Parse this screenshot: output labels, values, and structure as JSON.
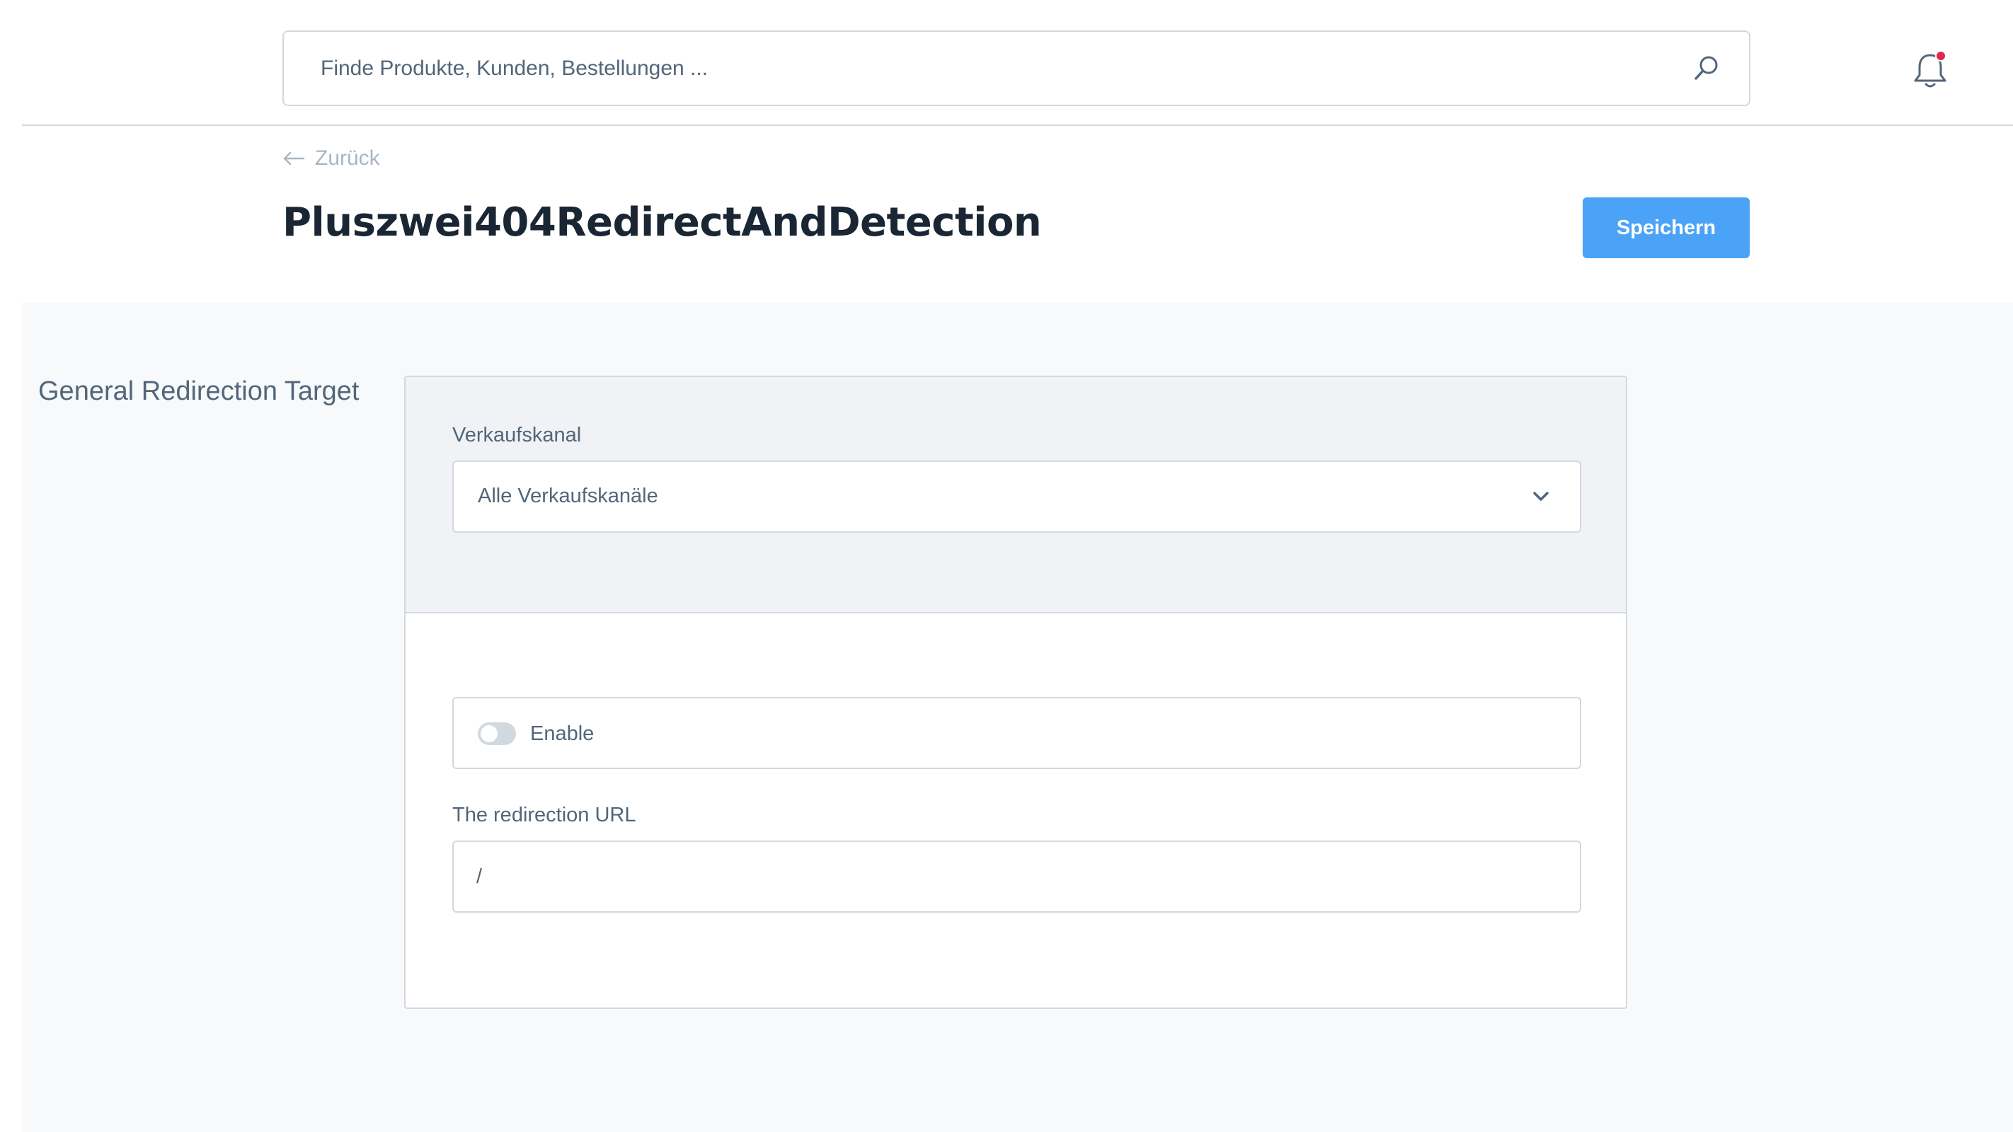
{
  "header": {
    "search": {
      "placeholder": "Finde Produkte, Kunden, Bestellungen ..."
    },
    "notification_dot_color": "#de294c"
  },
  "page": {
    "back_label": "Zurück",
    "title": "Pluszwei404RedirectAndDetection",
    "save_label": "Speichern",
    "accent_color": "#4ba3f7"
  },
  "section": {
    "title": "General Redirection Target",
    "sales_channel": {
      "label": "Verkaufskanal",
      "selected": "Alle Verkaufskanäle"
    },
    "enable": {
      "label": "Enable",
      "checked": false
    },
    "redirect_url": {
      "label": "The redirection URL",
      "value": "/"
    }
  }
}
